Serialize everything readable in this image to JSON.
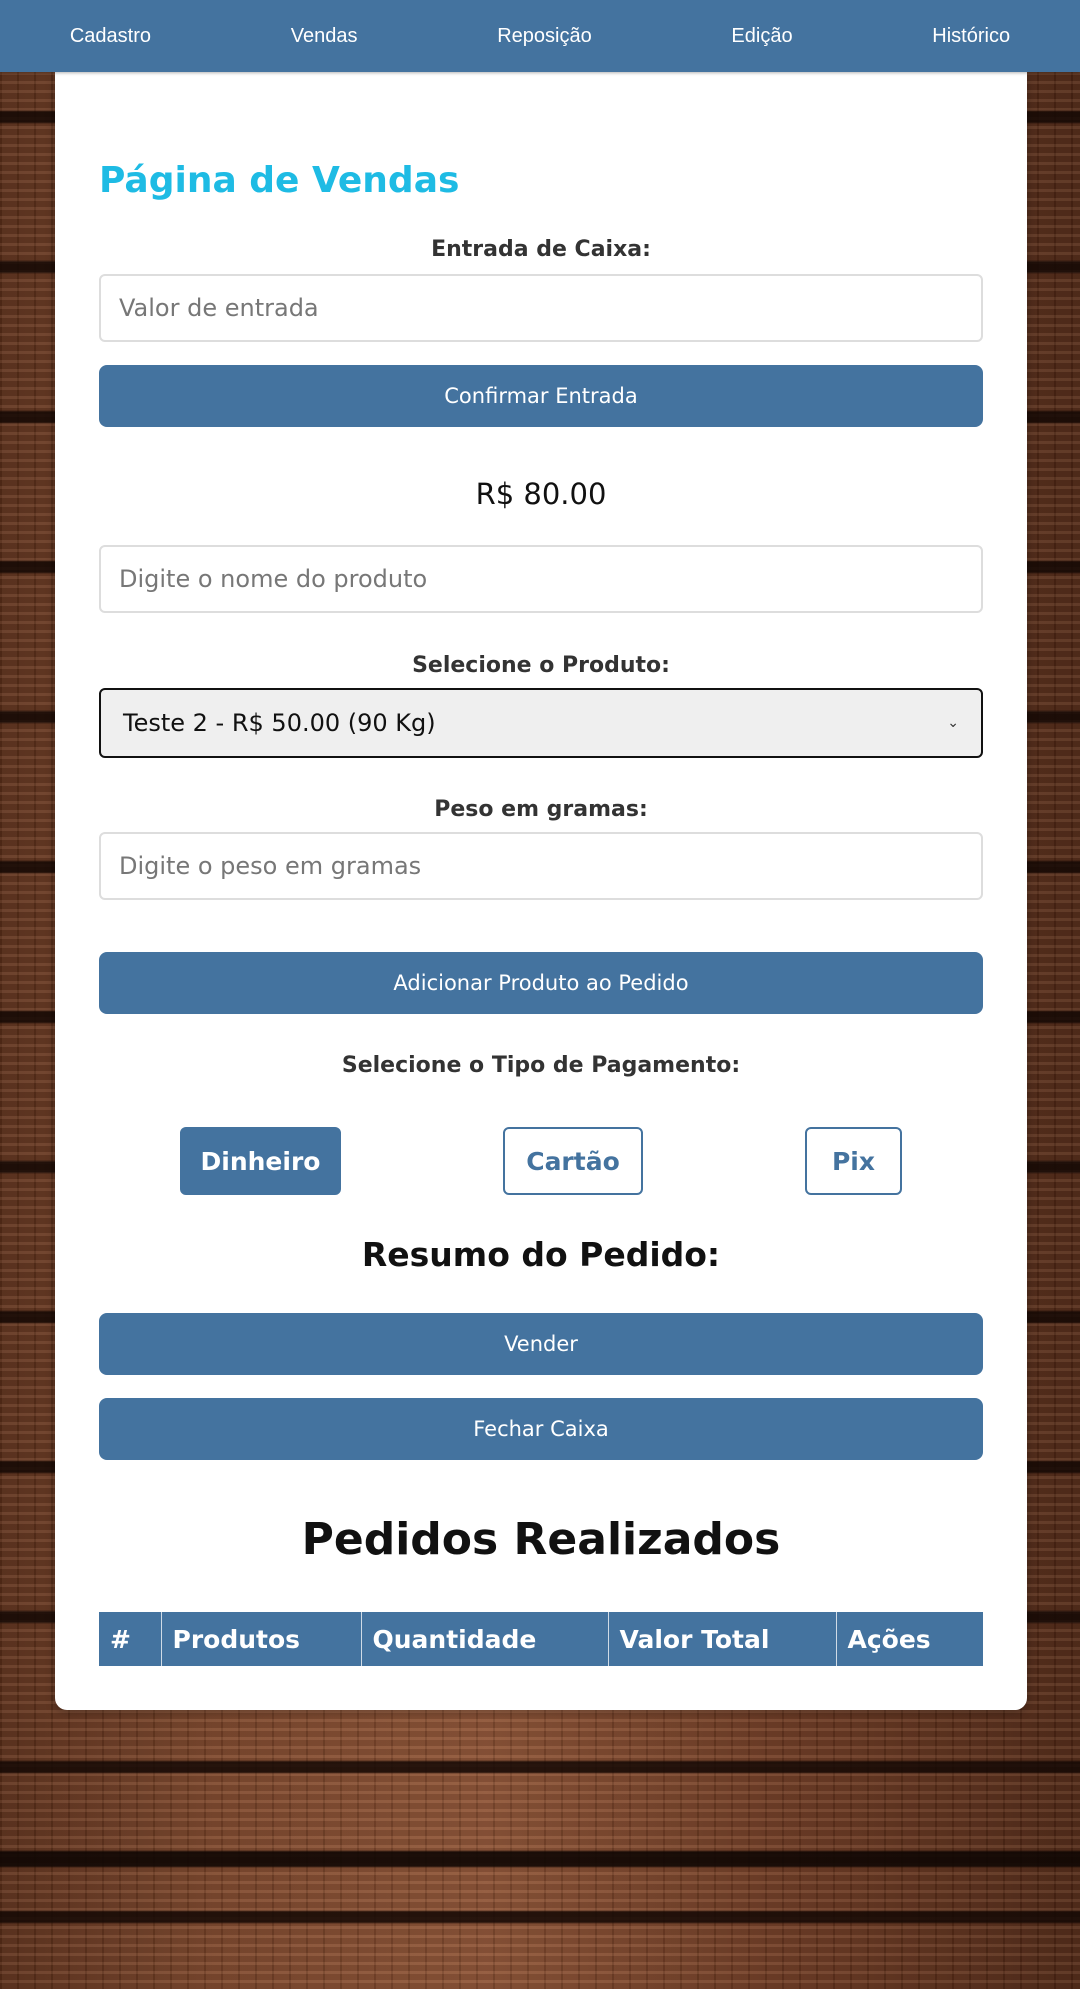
{
  "nav": {
    "items": [
      "Cadastro",
      "Vendas",
      "Reposição",
      "Edição",
      "Histórico"
    ]
  },
  "page": {
    "title": "Página de Vendas"
  },
  "cash_entry": {
    "label": "Entrada de Caixa:",
    "placeholder": "Valor de entrada",
    "confirm_label": "Confirmar Entrada"
  },
  "balance": "R$ 80.00",
  "product_search": {
    "placeholder": "Digite o nome do produto"
  },
  "product_select": {
    "label": "Selecione o Produto:",
    "selected": "Teste 2 - R$ 50.00 (90 Kg)"
  },
  "weight": {
    "label": "Peso em gramas:",
    "placeholder": "Digite o peso em gramas"
  },
  "add_product_label": "Adicionar Produto ao Pedido",
  "payment": {
    "label": "Selecione o Tipo de Pagamento:",
    "options": [
      "Dinheiro",
      "Cartão",
      "Pix"
    ],
    "selected": "Dinheiro"
  },
  "order_summary_title": "Resumo do Pedido:",
  "sell_label": "Vender",
  "close_register_label": "Fechar Caixa",
  "orders": {
    "title": "Pedidos Realizados",
    "columns": [
      "#",
      "Produtos",
      "Quantidade",
      "Valor Total",
      "Ações"
    ]
  },
  "colors": {
    "primary": "#44739f",
    "title_accent": "#1ebbe4"
  }
}
